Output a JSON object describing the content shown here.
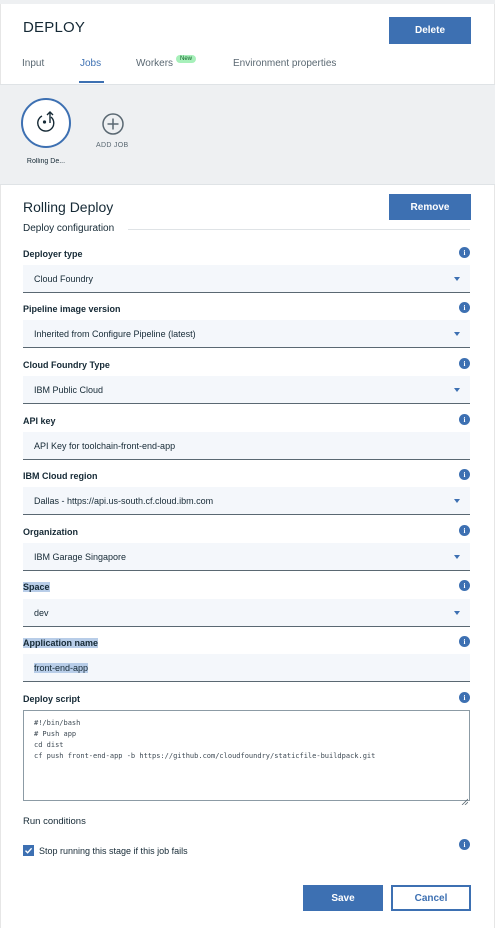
{
  "header": {
    "title": "DEPLOY",
    "delete_label": "Delete"
  },
  "tabs": [
    {
      "label": "Input",
      "active": false
    },
    {
      "label": "Jobs",
      "active": true
    },
    {
      "label": "Workers",
      "active": false,
      "badge": "New"
    },
    {
      "label": "Environment properties",
      "active": false
    }
  ],
  "jobs": {
    "items": [
      {
        "label": "Rolling De..."
      }
    ],
    "add_job_label": "ADD JOB"
  },
  "job": {
    "title": "Rolling Deploy",
    "remove_label": "Remove",
    "section_title": "Deploy configuration",
    "fields": {
      "deployer_type": {
        "label": "Deployer type",
        "value": "Cloud Foundry"
      },
      "pipeline_image": {
        "label": "Pipeline image version",
        "value": "Inherited from Configure Pipeline (latest)"
      },
      "cf_type": {
        "label": "Cloud Foundry Type",
        "value": "IBM Public Cloud"
      },
      "api_key": {
        "label": "API key",
        "value": "API Key for toolchain-front-end-app"
      },
      "region": {
        "label": "IBM Cloud region",
        "value": "Dallas - https://api.us-south.cf.cloud.ibm.com"
      },
      "organization": {
        "label": "Organization",
        "value": "IBM Garage Singapore"
      },
      "space": {
        "label": "Space",
        "value": "dev"
      },
      "app_name": {
        "label": "Application name",
        "value": "front-end-app"
      },
      "deploy_script": {
        "label": "Deploy script",
        "lines": [
          "#!/bin/bash",
          "# Push app",
          "cd dist",
          "cf push front-end-app -b https://github.com/cloudfoundry/staticfile-buildpack.git"
        ]
      }
    },
    "run_conditions": {
      "title": "Run conditions",
      "stop_on_fail_label": "Stop running this stage if this job fails",
      "stop_on_fail_checked": true
    }
  },
  "footer": {
    "save_label": "Save",
    "cancel_label": "Cancel"
  },
  "colors": {
    "accent": "#3d70b2",
    "text": "#152935",
    "field_bg": "#f4f7fb",
    "strip_bg": "#eef0f2",
    "selection": "#b8cde8",
    "badge_bg": "#a7f0ba"
  },
  "icons": {
    "job": "deploy-job-icon",
    "add_job": "plus-circle-icon",
    "info": "info-icon",
    "dropdown": "chevron-down-icon",
    "check": "checkmark-icon"
  }
}
